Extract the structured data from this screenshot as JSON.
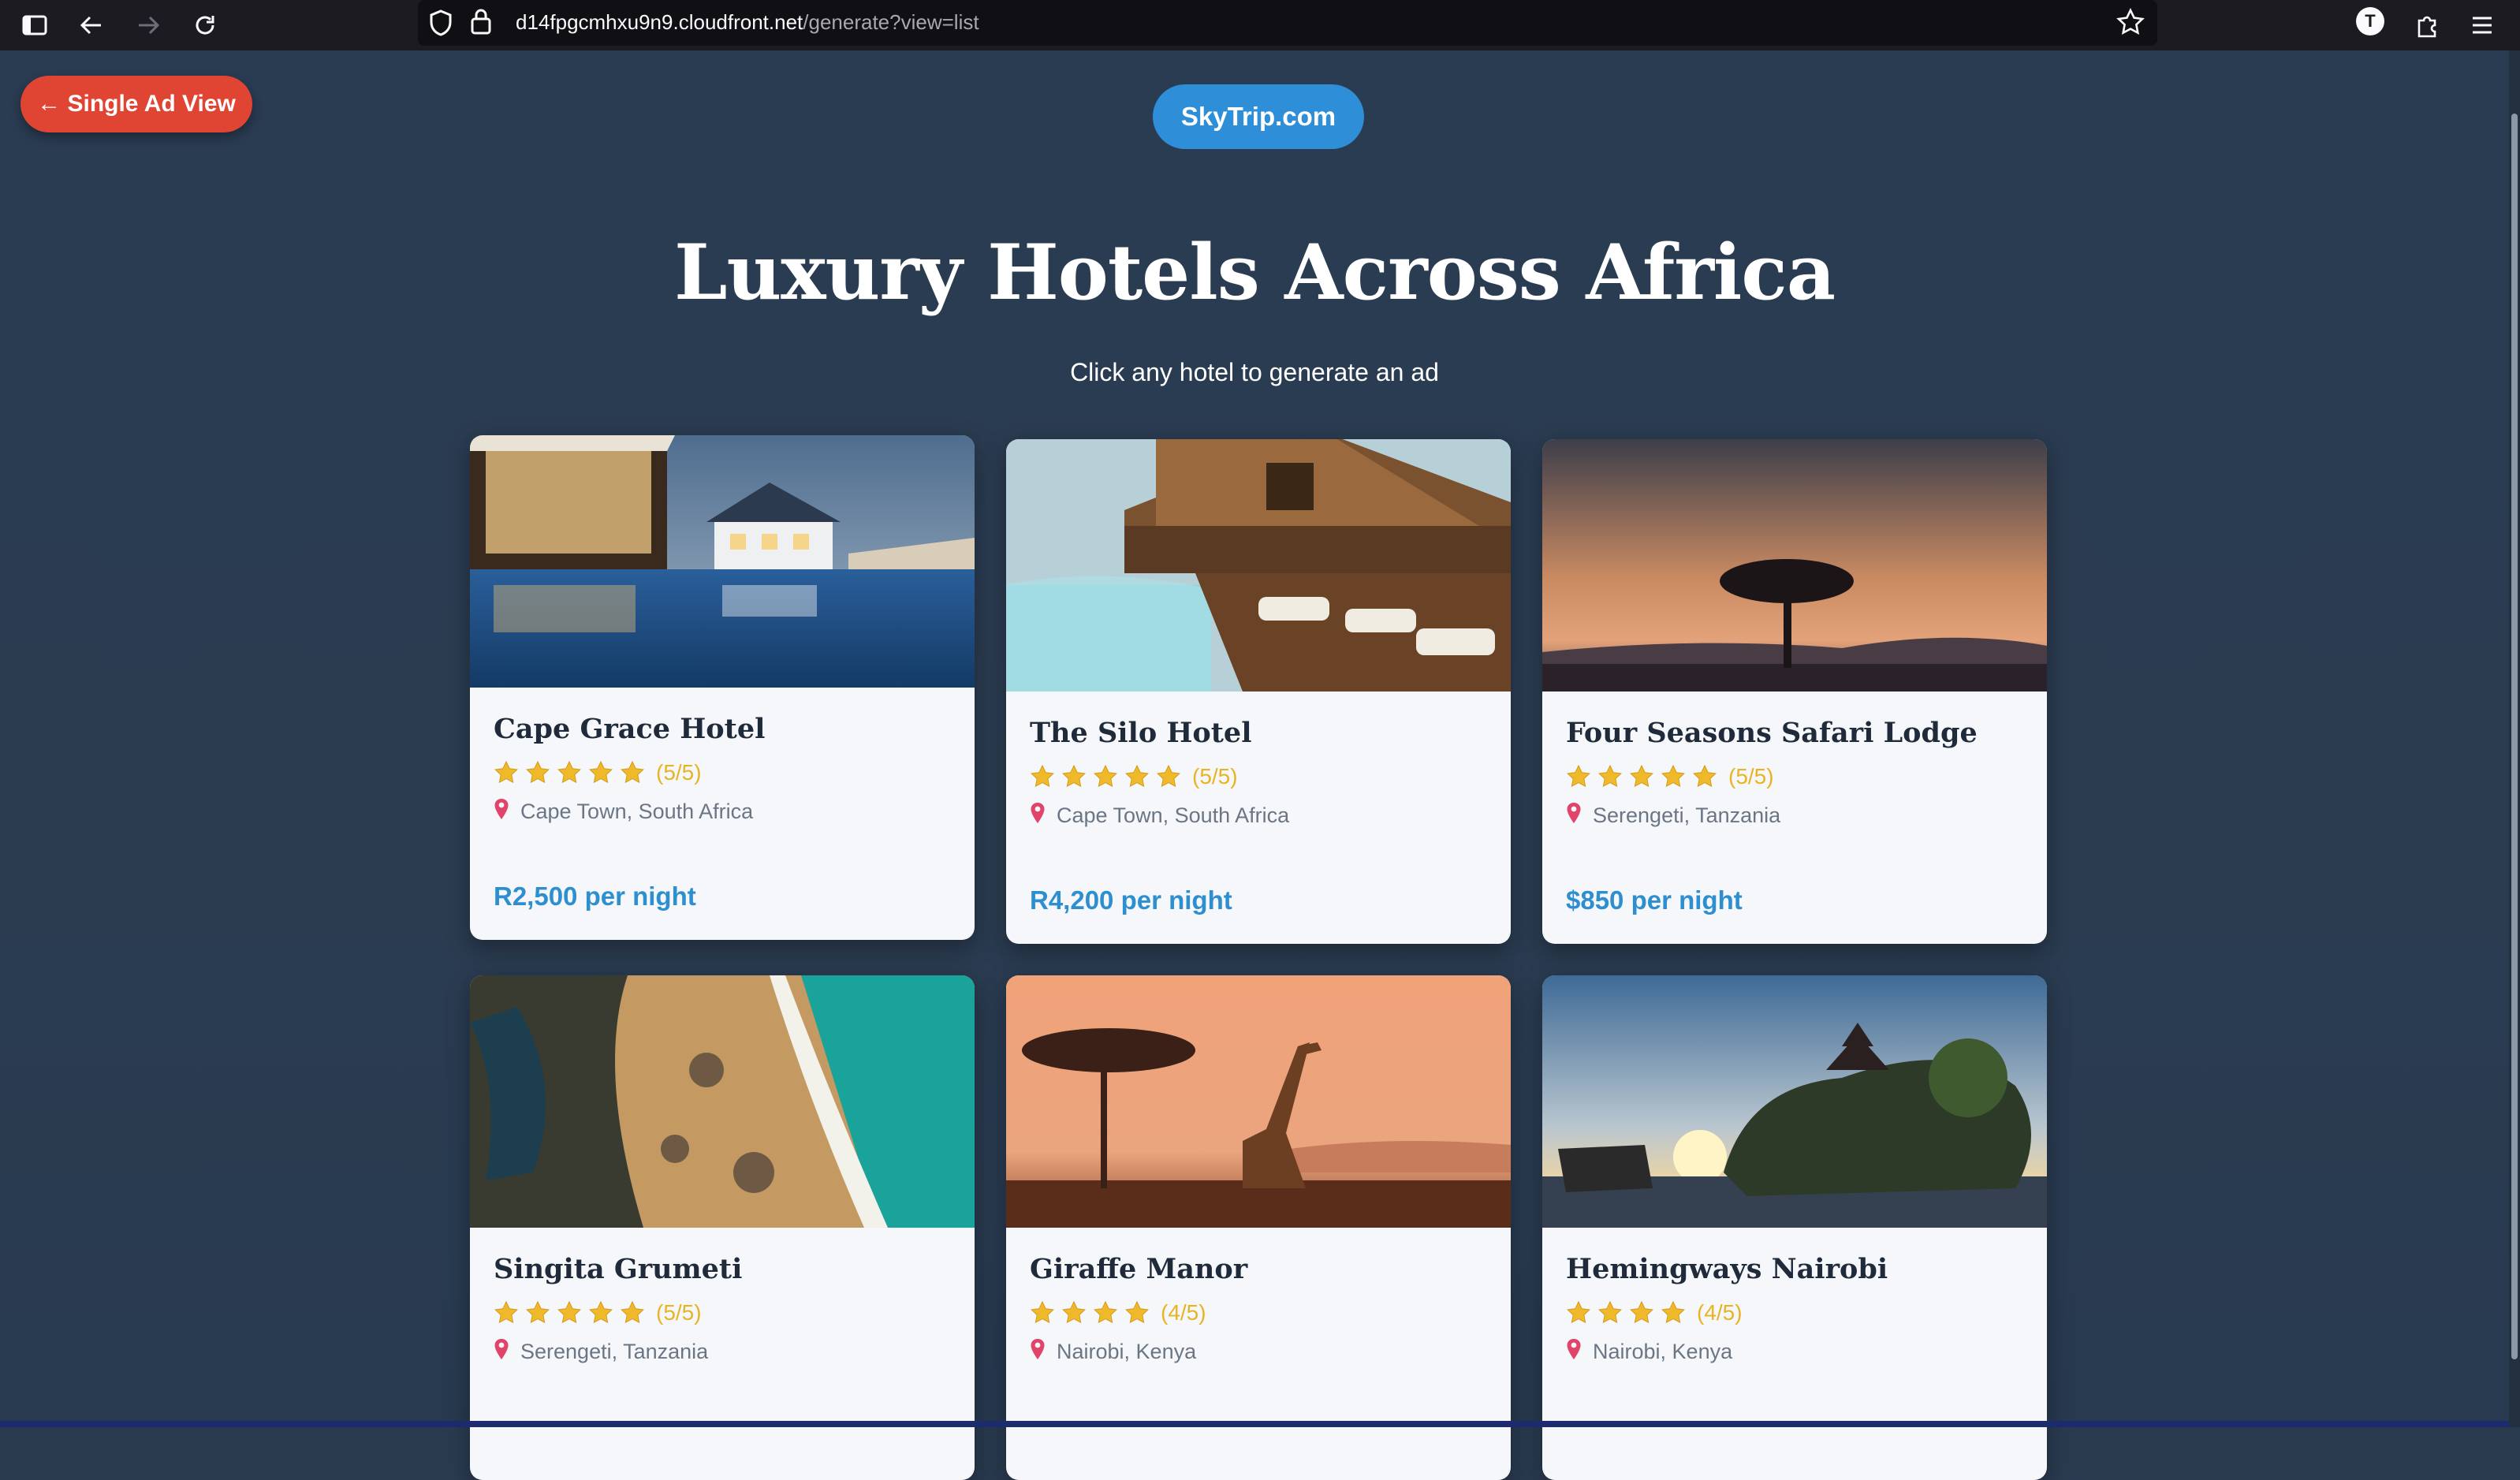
{
  "browser": {
    "url_host": "d14fpgcmhxu9n9.cloudfront.net",
    "url_path": "/generate?view=list",
    "account_initial": "T"
  },
  "header": {
    "back_label": "← Single Ad View",
    "brand_label": "SkyTrip.com"
  },
  "main": {
    "title": "Luxury Hotels Across Africa",
    "subtitle": "Click any hotel to generate an ad"
  },
  "colors": {
    "page_bg": "#2a3b50",
    "back_button": "#e04433",
    "brand_button": "#2e8fd8",
    "price_text": "#2e8fd0",
    "star": "#f0b92a"
  },
  "hotels": [
    {
      "name": "Cape Grace Hotel",
      "stars": 5,
      "rating_text": "(5/5)",
      "location": "Cape Town, South Africa",
      "price": "R2,500 per night",
      "image": "pool-terrace-night"
    },
    {
      "name": "The Silo Hotel",
      "stars": 5,
      "rating_text": "(5/5)",
      "location": "Cape Town, South Africa",
      "price": "R4,200 per night",
      "image": "lodge-pool-deck"
    },
    {
      "name": "Four Seasons Safari Lodge",
      "stars": 5,
      "rating_text": "(5/5)",
      "location": "Serengeti, Tanzania",
      "price": "$850 per night",
      "image": "savanna-sunset-acacia"
    },
    {
      "name": "Singita Grumeti",
      "stars": 5,
      "rating_text": "(5/5)",
      "location": "Serengeti, Tanzania",
      "price": "",
      "image": "aerial-coastline"
    },
    {
      "name": "Giraffe Manor",
      "stars": 4,
      "rating_text": "(4/5)",
      "location": "Nairobi, Kenya",
      "price": "",
      "image": "giraffe-sunset"
    },
    {
      "name": "Hemingways Nairobi",
      "stars": 4,
      "rating_text": "(4/5)",
      "location": "Nairobi, Kenya",
      "price": "",
      "image": "temple-rock-sunset"
    }
  ]
}
